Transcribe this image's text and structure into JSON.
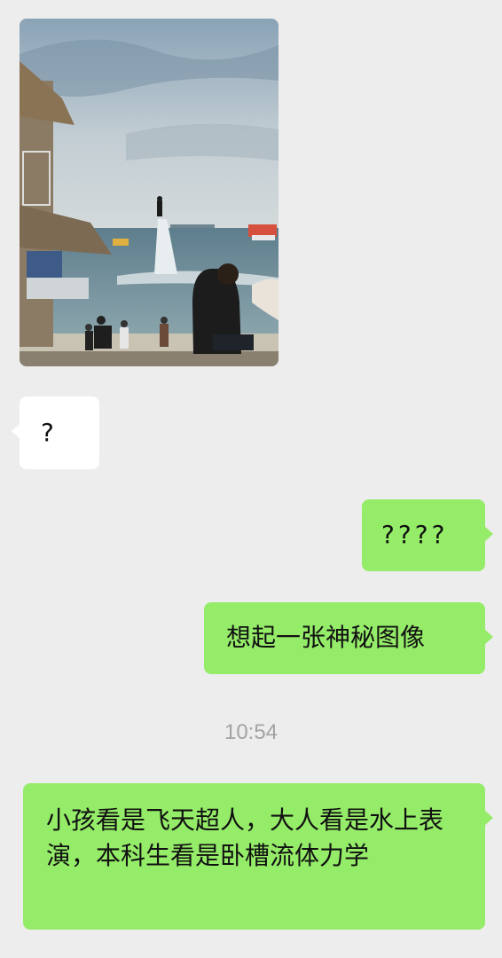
{
  "chat": {
    "messages": [
      {
        "side": "left",
        "type": "image",
        "alt": ""
      },
      {
        "side": "left",
        "type": "text",
        "text": "?"
      },
      {
        "side": "right",
        "type": "text",
        "text": "????"
      },
      {
        "side": "right",
        "type": "text",
        "text": "想起一张神秘图像"
      },
      {
        "side": "right",
        "type": "text",
        "text": "小孩看是飞天超人，大人看是水上表演，本科生看是卧槽流体力学"
      }
    ],
    "timestamp": "10:54"
  },
  "colors": {
    "background": "#ededed",
    "incoming_bubble": "#ffffff",
    "outgoing_bubble": "#95ec69",
    "timestamp": "#a3a3a3"
  }
}
